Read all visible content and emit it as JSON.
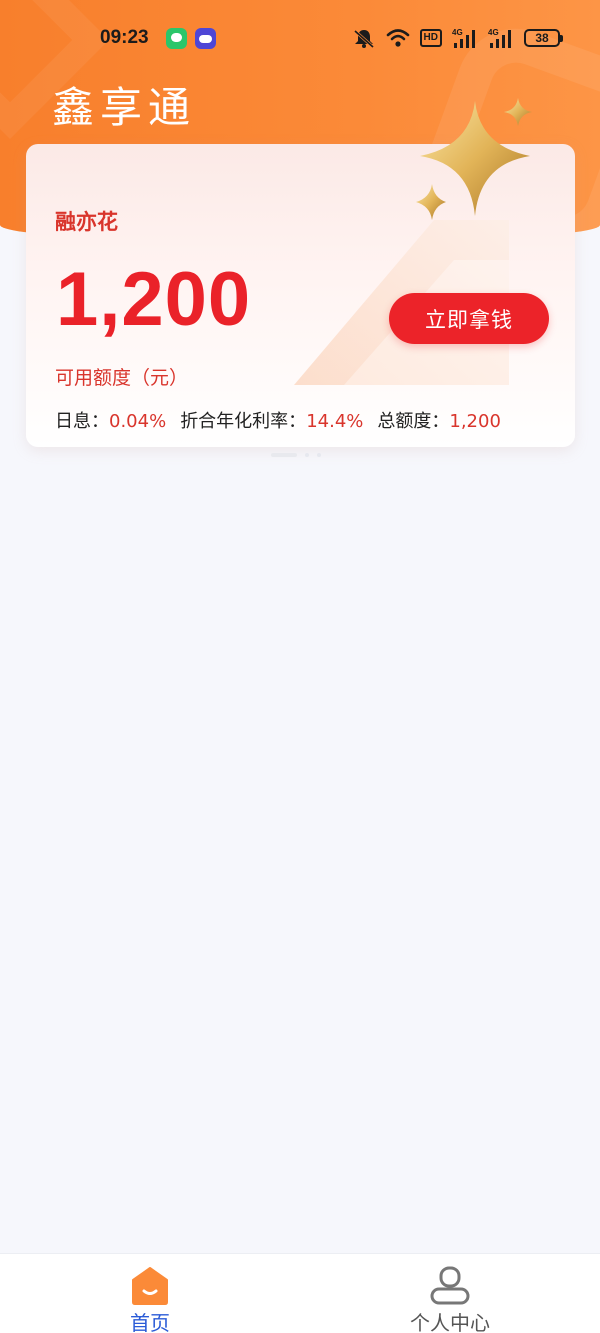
{
  "status_bar": {
    "time": "09:23",
    "hd_label": "HD",
    "network_1": "4G",
    "network_2": "4G",
    "battery": "38"
  },
  "header": {
    "app_title": "鑫享通"
  },
  "card": {
    "product_name": "融亦花",
    "available_amount": "1,200",
    "available_label": "可用额度（元）",
    "cta_label": "立即拿钱",
    "daily_rate_label": "日息：",
    "daily_rate_value": "0.04%",
    "annual_rate_label": "折合年化利率：",
    "annual_rate_value": "14.4%",
    "total_label": "总额度：",
    "total_value": "1,200"
  },
  "pager": {
    "count": 3,
    "active": 0
  },
  "bottom_nav": {
    "home_label": "首页",
    "profile_label": "个人中心"
  },
  "colors": {
    "header": "#f87f2c",
    "accent_red": "#ec2329",
    "text_red": "#d9352c",
    "nav_active": "#2a5bd7"
  },
  "icons": [
    "bell-muted-icon",
    "wifi-icon",
    "signal-icon",
    "battery-icon",
    "home-icon",
    "user-icon",
    "star-sparkle-icon"
  ]
}
